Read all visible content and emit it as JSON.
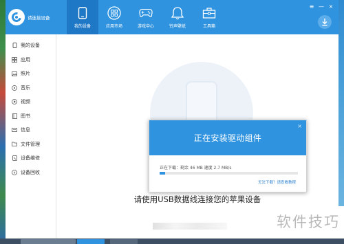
{
  "app": {
    "logo_text": "请连接设备"
  },
  "nav": [
    {
      "label": "我的设备",
      "icon": "phone-icon",
      "active": true
    },
    {
      "label": "应用市场",
      "icon": "apps-icon",
      "active": false
    },
    {
      "label": "游戏中心",
      "icon": "gamepad-icon",
      "active": false
    },
    {
      "label": "铃声壁纸",
      "icon": "bell-icon",
      "active": false
    },
    {
      "label": "工具箱",
      "icon": "toolbox-icon",
      "active": false
    }
  ],
  "window_controls": {
    "menu": "≡",
    "minimize": "—",
    "close": "×"
  },
  "sidebar": {
    "items": [
      {
        "label": "我的设备",
        "icon": "device-icon"
      },
      {
        "label": "应用",
        "icon": "grid-icon"
      },
      {
        "label": "照片",
        "icon": "photo-icon"
      },
      {
        "label": "音乐",
        "icon": "music-icon"
      },
      {
        "label": "视频",
        "icon": "video-icon"
      },
      {
        "label": "图书",
        "icon": "book-icon"
      },
      {
        "label": "信息",
        "icon": "message-icon"
      },
      {
        "label": "文件管理",
        "icon": "folder-icon"
      },
      {
        "label": "设备维修",
        "icon": "repair-icon"
      },
      {
        "label": "设备回收",
        "icon": "recycle-icon"
      }
    ]
  },
  "main": {
    "prompt": "请使用USB数据线连接您的苹果设备"
  },
  "dialog": {
    "title": "正在安装驱动组件",
    "close": "×",
    "status": "正在下载：剩余 46 MB 速度 2.7 MB/s",
    "progress_fraction": 0.04,
    "link": "无法下载？请查看教程"
  },
  "watermark": {
    "text": "软件技巧"
  },
  "colors": {
    "accent": "#2f93df",
    "accent_dark": "#1f78c5",
    "link": "#2f83d0"
  }
}
